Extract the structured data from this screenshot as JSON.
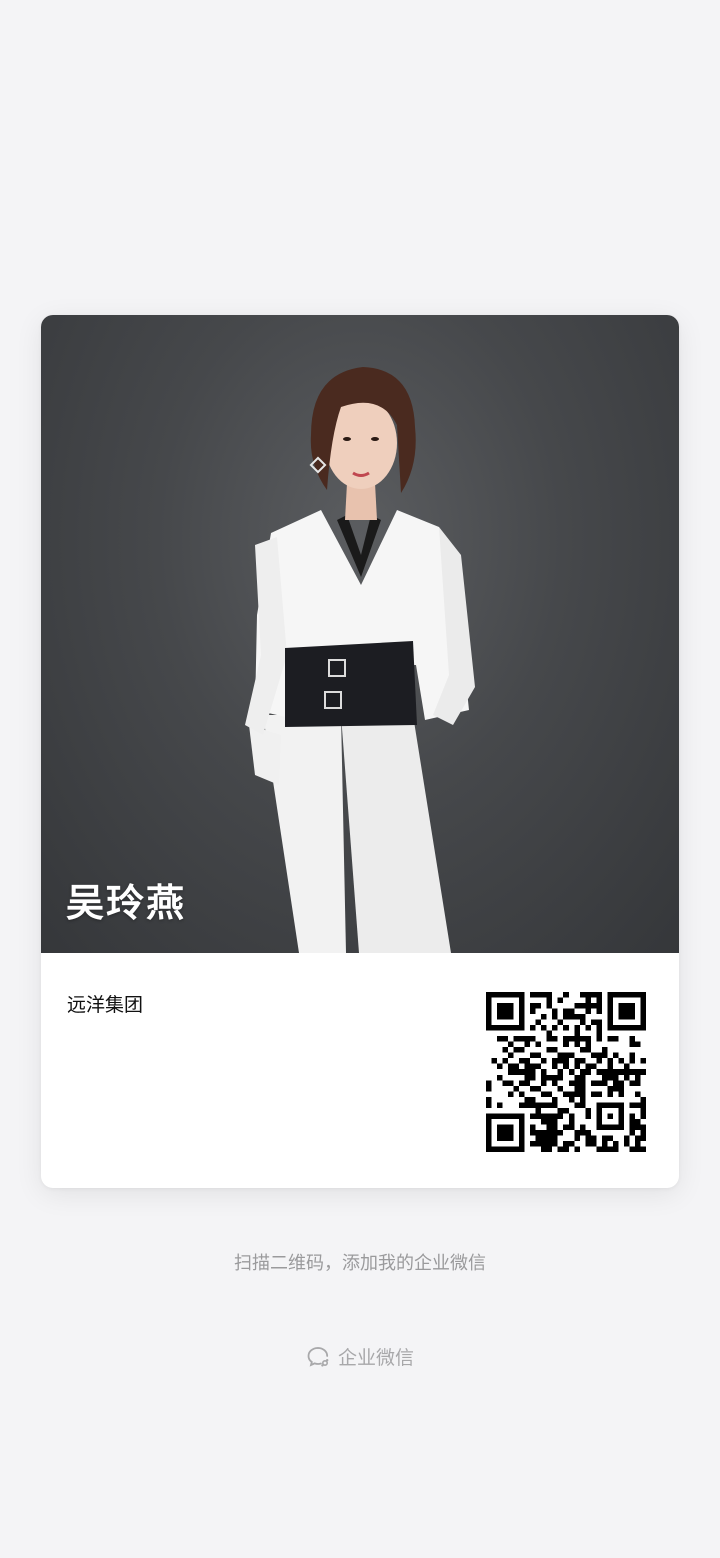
{
  "card": {
    "name": "吴玲燕",
    "company": "远洋集团",
    "photo_icon": "profile-photo",
    "qr_icon": "qr-code"
  },
  "footer": {
    "hint": "扫描二维码，添加我的企业微信",
    "brand_label": "企业微信",
    "brand_icon": "wecom-chat-icon"
  },
  "colors": {
    "background": "#f4f4f6",
    "photo_bg": "#46484b",
    "muted_text": "#9a9a9c"
  }
}
